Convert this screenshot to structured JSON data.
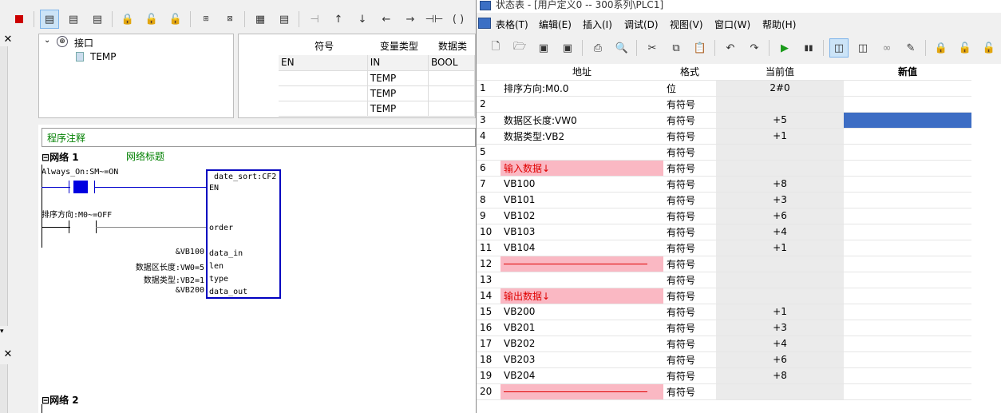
{
  "left": {
    "tree": {
      "root_label": "接口",
      "child_label": "TEMP"
    },
    "interface_table": {
      "headers": [
        "符号",
        "变量类型",
        "数据类"
      ],
      "rows": [
        {
          "symbol": "EN",
          "vartype": "IN",
          "datatype": "BOOL"
        },
        {
          "symbol": "",
          "vartype": "TEMP",
          "datatype": ""
        },
        {
          "symbol": "",
          "vartype": "TEMP",
          "datatype": ""
        },
        {
          "symbol": "",
          "vartype": "TEMP",
          "datatype": ""
        }
      ]
    },
    "ladder": {
      "program_comment": "程序注释",
      "network1_label": "网络 1",
      "network1_title": "网络标题",
      "contact1_label": "Always_On:SM~=ON",
      "contact2_label": "排序方向:M0~=OFF",
      "block_name": "date_sort:CF2",
      "pins": [
        "EN",
        "order",
        "data_in",
        "len",
        "type",
        "data_out"
      ],
      "inputs": [
        "&VB100",
        "数据区长度:VW0=5",
        "数据类型:VB2=1",
        "&VB200"
      ],
      "network2_label": "网络 2"
    }
  },
  "right": {
    "title": "状态表 - [用户定义0 -- 300系列\\PLC1]",
    "menu": [
      "表格(T)",
      "编辑(E)",
      "插入(I)",
      "调试(D)",
      "视图(V)",
      "窗口(W)",
      "帮助(H)"
    ],
    "columns": [
      "地址",
      "格式",
      "当前值",
      "新值"
    ],
    "rows": [
      {
        "n": "1",
        "addr": "排序方向:M0.0",
        "fmt": "位",
        "val": "2#0"
      },
      {
        "n": "2",
        "addr": "",
        "fmt": "有符号",
        "val": ""
      },
      {
        "n": "3",
        "addr": "数据区长度:VW0",
        "fmt": "有符号",
        "val": "+5"
      },
      {
        "n": "4",
        "addr": "数据类型:VB2",
        "fmt": "有符号",
        "val": "+1"
      },
      {
        "n": "5",
        "addr": "",
        "fmt": "有符号",
        "val": ""
      },
      {
        "n": "6",
        "addr": "输入数据↓",
        "fmt": "有符号",
        "val": ""
      },
      {
        "n": "7",
        "addr": "VB100",
        "fmt": "有符号",
        "val": "+8"
      },
      {
        "n": "8",
        "addr": "VB101",
        "fmt": "有符号",
        "val": "+3"
      },
      {
        "n": "9",
        "addr": "VB102",
        "fmt": "有符号",
        "val": "+6"
      },
      {
        "n": "10",
        "addr": "VB103",
        "fmt": "有符号",
        "val": "+4"
      },
      {
        "n": "11",
        "addr": "VB104",
        "fmt": "有符号",
        "val": "+1"
      },
      {
        "n": "12",
        "addr": "",
        "fmt": "有符号",
        "val": ""
      },
      {
        "n": "13",
        "addr": "",
        "fmt": "有符号",
        "val": ""
      },
      {
        "n": "14",
        "addr": "输出数据↓",
        "fmt": "有符号",
        "val": ""
      },
      {
        "n": "15",
        "addr": "VB200",
        "fmt": "有符号",
        "val": "+1"
      },
      {
        "n": "16",
        "addr": "VB201",
        "fmt": "有符号",
        "val": "+3"
      },
      {
        "n": "17",
        "addr": "VB202",
        "fmt": "有符号",
        "val": "+4"
      },
      {
        "n": "18",
        "addr": "VB203",
        "fmt": "有符号",
        "val": "+6"
      },
      {
        "n": "19",
        "addr": "VB204",
        "fmt": "有符号",
        "val": "+8"
      },
      {
        "n": "20",
        "addr": "",
        "fmt": "有符号",
        "val": ""
      }
    ]
  },
  "colors": {
    "selection": "#3d6dc4",
    "pink": "#fab8c3",
    "block_blue": "#0000c8",
    "comment_green": "#008000",
    "separator_red": "#e00000"
  }
}
